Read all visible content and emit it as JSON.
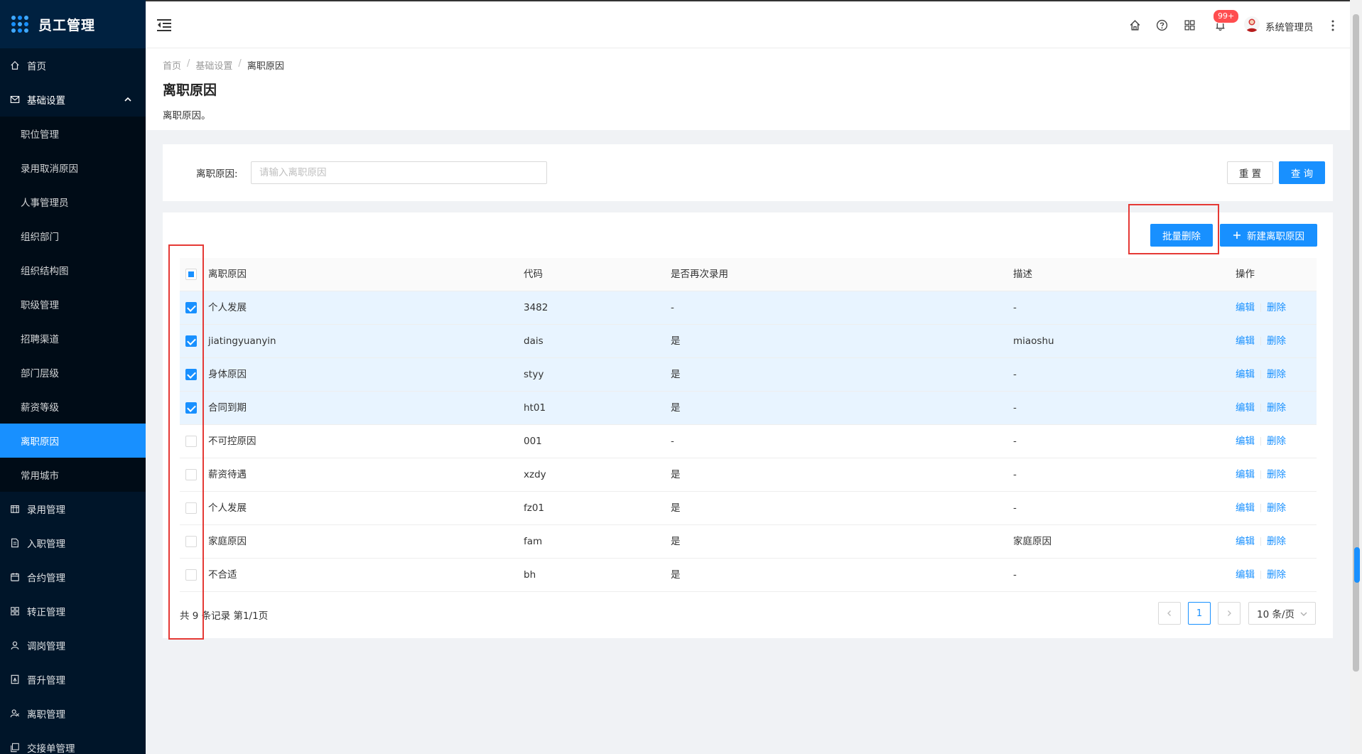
{
  "app": {
    "title": "员工管理"
  },
  "sidebar": {
    "top_items": [
      {
        "label": "首页",
        "icon": "home-icon"
      }
    ],
    "open_group": {
      "label": "基础设置",
      "icon": "mail-icon"
    },
    "sub_items": [
      {
        "label": "职位管理"
      },
      {
        "label": "录用取消原因"
      },
      {
        "label": "人事管理员"
      },
      {
        "label": "组织部门"
      },
      {
        "label": "组织结构图"
      },
      {
        "label": "职级管理"
      },
      {
        "label": "招聘渠道"
      },
      {
        "label": "部门层级"
      },
      {
        "label": "薪资等级"
      },
      {
        "label": "离职原因",
        "active": true
      },
      {
        "label": "常用城市"
      }
    ],
    "bottom_items": [
      {
        "label": "录用管理",
        "icon": "calendar-icon"
      },
      {
        "label": "入职管理",
        "icon": "document-icon"
      },
      {
        "label": "合约管理",
        "icon": "contract-icon"
      },
      {
        "label": "转正管理",
        "icon": "grid-icon"
      },
      {
        "label": "调岗管理",
        "icon": "user-icon"
      },
      {
        "label": "晋升管理",
        "icon": "promotion-icon"
      },
      {
        "label": "离职管理",
        "icon": "leave-icon"
      },
      {
        "label": "交接单管理",
        "icon": "handover-icon"
      }
    ]
  },
  "header": {
    "notification_badge": "99+",
    "user_name": "系统管理员"
  },
  "breadcrumb": [
    "首页",
    "基础设置",
    "离职原因"
  ],
  "page": {
    "title": "离职原因",
    "description": "离职原因。"
  },
  "search": {
    "label": "离职原因:",
    "placeholder": "请输入离职原因",
    "reset_label": "重 置",
    "query_label": "查 询"
  },
  "toolbar": {
    "batch_delete_label": "批量删除",
    "new_label": "新建离职原因"
  },
  "table": {
    "columns": [
      "离职原因",
      "代码",
      "是否再次录用",
      "描述",
      "操作"
    ],
    "action_edit": "编辑",
    "action_delete": "删除",
    "rows": [
      {
        "reason": "个人发展",
        "code": "3482",
        "rehire": "-",
        "desc": "-",
        "checked": true
      },
      {
        "reason": "jiatingyuanyin",
        "code": "dais",
        "rehire": "是",
        "desc": "miaoshu",
        "checked": true
      },
      {
        "reason": "身体原因",
        "code": "styy",
        "rehire": "是",
        "desc": "-",
        "checked": true
      },
      {
        "reason": "合同到期",
        "code": "ht01",
        "rehire": "是",
        "desc": "-",
        "checked": true
      },
      {
        "reason": "不可控原因",
        "code": "001",
        "rehire": "-",
        "desc": "-",
        "checked": false
      },
      {
        "reason": "薪资待遇",
        "code": "xzdy",
        "rehire": "是",
        "desc": "-",
        "checked": false
      },
      {
        "reason": "个人发展",
        "code": "fz01",
        "rehire": "是",
        "desc": "-",
        "checked": false
      },
      {
        "reason": "家庭原因",
        "code": "fam",
        "rehire": "是",
        "desc": "家庭原因",
        "checked": false
      },
      {
        "reason": "不合适",
        "code": "bh",
        "rehire": "是",
        "desc": "-",
        "checked": false
      }
    ]
  },
  "pagination": {
    "total_text": "共 9 条记录 第1/1页",
    "current_page": "1",
    "page_size": "10 条/页"
  },
  "colors": {
    "primary": "#1890ff",
    "sidebar_bg": "#001529",
    "highlight": "#e53935",
    "badge": "#ff4d4f"
  }
}
